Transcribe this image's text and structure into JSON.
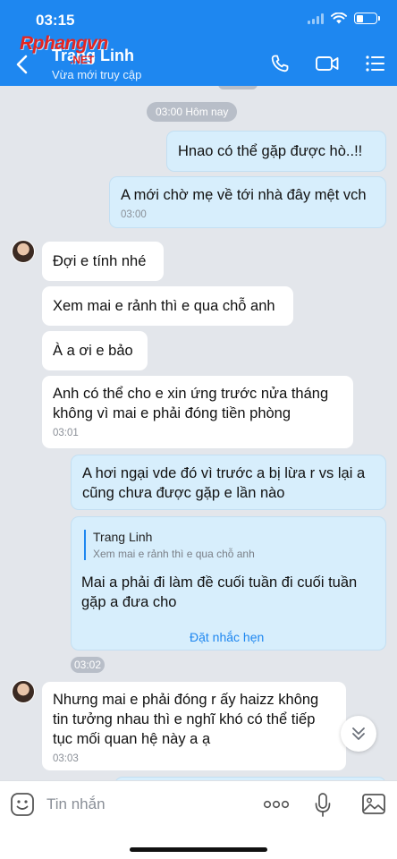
{
  "status_bar": {
    "time": "03:15"
  },
  "header": {
    "contact_name": "Trang Linh",
    "contact_status": "Vừa mới truy cập",
    "watermark": "Rphangvn",
    "watermark_suffix": ".NET",
    "accent_color": "#1e87f0"
  },
  "icons": {
    "back": "chevron-left-icon",
    "call": "phone-icon",
    "video": "video-camera-icon",
    "menu": "list-menu-icon",
    "sticker": "smiley-icon",
    "more": "ellipsis-icon",
    "voice": "microphone-icon",
    "photo": "image-icon",
    "scroll": "chevron-double-down-icon"
  },
  "chat": {
    "date_separator": "03:00 Hôm nay",
    "messages": [
      {
        "side": "out",
        "text": "Hnao có thể gặp được hò..!!"
      },
      {
        "side": "out",
        "text": "A mới chờ mẹ về tới nhà đây mệt vch",
        "time": "03:00"
      },
      {
        "side": "in",
        "text": "Đợi e tính nhé"
      },
      {
        "side": "in",
        "text": "Xem mai e rảnh thì e qua chỗ anh"
      },
      {
        "side": "in",
        "text": "À a ơi e bảo"
      },
      {
        "side": "in",
        "text_lines": [
          "Anh có thể cho e xin ứng trước nửa tháng",
          "không vì mai e phải đóng tiền phòng"
        ],
        "time": "03:01"
      },
      {
        "side": "out",
        "text_lines": [
          "A hơi ngại vde đó vì trước a bị lừa r vs lại a",
          "cũng chưa được gặp e lần nào"
        ]
      },
      {
        "side": "out",
        "quote": {
          "name": "Trang Linh",
          "text": "Xem mai e rảnh thì e qua chỗ anh"
        },
        "text_lines": [
          "Mai a phải đi làm đề cuối tuần đi cuối tuần",
          "gặp a đưa cho"
        ],
        "action": "Đặt nhắc hẹn",
        "time": "03:02"
      },
      {
        "side": "in",
        "text_lines": [
          "Nhưng mai e phải đóng r ấy haizz không",
          "tin tưởng nhau thì e nghĩ khó có thể tiếp",
          "tục mối quan hệ này a ạ"
        ],
        "time": "03:03"
      }
    ]
  },
  "composer": {
    "placeholder": "Tin nhắn"
  }
}
